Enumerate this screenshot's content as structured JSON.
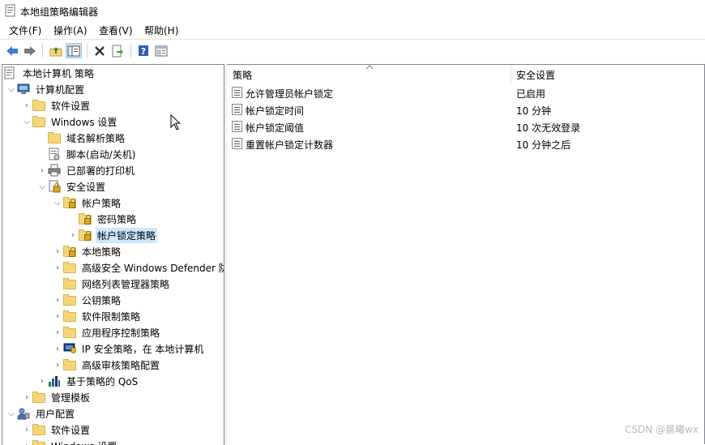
{
  "window": {
    "title": "本地组策略编辑器"
  },
  "menu": [
    "文件(F)",
    "操作(A)",
    "查看(V)",
    "帮助(H)"
  ],
  "toolbar": [
    {
      "icon": "back-arrow-icon"
    },
    {
      "icon": "forward-arrow-icon"
    },
    {
      "icon": "up-folder-icon"
    },
    {
      "icon": "show-hide-tree-icon"
    },
    {
      "icon": "delete-icon"
    },
    {
      "icon": "export-list-icon"
    },
    {
      "icon": "help-icon"
    },
    {
      "icon": "properties-icon"
    }
  ],
  "tree": [
    {
      "label": "本地计算机 策略",
      "icon": "policy-icon",
      "expander": ""
    },
    {
      "label": "计算机配置",
      "icon": "computer-icon",
      "expander": "down"
    },
    {
      "label": "软件设置",
      "icon": "folder-icon",
      "expander": "right"
    },
    {
      "label": "Windows 设置",
      "icon": "folder-icon",
      "expander": "down"
    },
    {
      "label": "域名解析策略",
      "icon": "folder-icon",
      "expander": ""
    },
    {
      "label": "脚本(启动/关机)",
      "icon": "script-icon",
      "expander": ""
    },
    {
      "label": "已部署的打印机",
      "icon": "printer-icon",
      "expander": "right"
    },
    {
      "label": "安全设置",
      "icon": "security-icon",
      "expander": "down"
    },
    {
      "label": "帐户策略",
      "icon": "lock-folder-icon",
      "expander": "down"
    },
    {
      "label": "密码策略",
      "icon": "lock-folder-icon",
      "expander": ""
    },
    {
      "label": "帐户锁定策略",
      "icon": "lock-folder-icon",
      "expander": "right",
      "selected": true
    },
    {
      "label": "本地策略",
      "icon": "lock-folder-icon",
      "expander": "right"
    },
    {
      "label": "高级安全 Windows Defender 防",
      "icon": "folder-icon",
      "expander": "right"
    },
    {
      "label": "网络列表管理器策略",
      "icon": "folder-icon",
      "expander": ""
    },
    {
      "label": "公钥策略",
      "icon": "folder-icon",
      "expander": "right"
    },
    {
      "label": "软件限制策略",
      "icon": "folder-icon",
      "expander": "right"
    },
    {
      "label": "应用程序控制策略",
      "icon": "folder-icon",
      "expander": "right"
    },
    {
      "label": "IP 安全策略，在 本地计算机",
      "icon": "ip-security-icon",
      "expander": "right"
    },
    {
      "label": "高级审核策略配置",
      "icon": "folder-icon",
      "expander": "right"
    },
    {
      "label": "基于策略的 QoS",
      "icon": "qos-chart-icon",
      "expander": "right"
    },
    {
      "label": "管理模板",
      "icon": "folder-icon",
      "expander": "right"
    },
    {
      "label": "用户配置",
      "icon": "user-icon",
      "expander": "down"
    },
    {
      "label": "软件设置",
      "icon": "folder-icon",
      "expander": "right"
    },
    {
      "label": "Windows 设置",
      "icon": "folder-icon",
      "expander": "right"
    }
  ],
  "list": {
    "headers": [
      "策略",
      "安全设置"
    ],
    "rows": [
      {
        "name": "允许管理员帐户锁定",
        "value": "已启用"
      },
      {
        "name": "帐户锁定时间",
        "value": "10 分钟"
      },
      {
        "name": "帐户锁定阈值",
        "value": "10 次无效登录"
      },
      {
        "name": "重置帐户锁定计数器",
        "value": "10 分钟之后"
      }
    ]
  },
  "watermark": "CSDN @晨曦wx"
}
